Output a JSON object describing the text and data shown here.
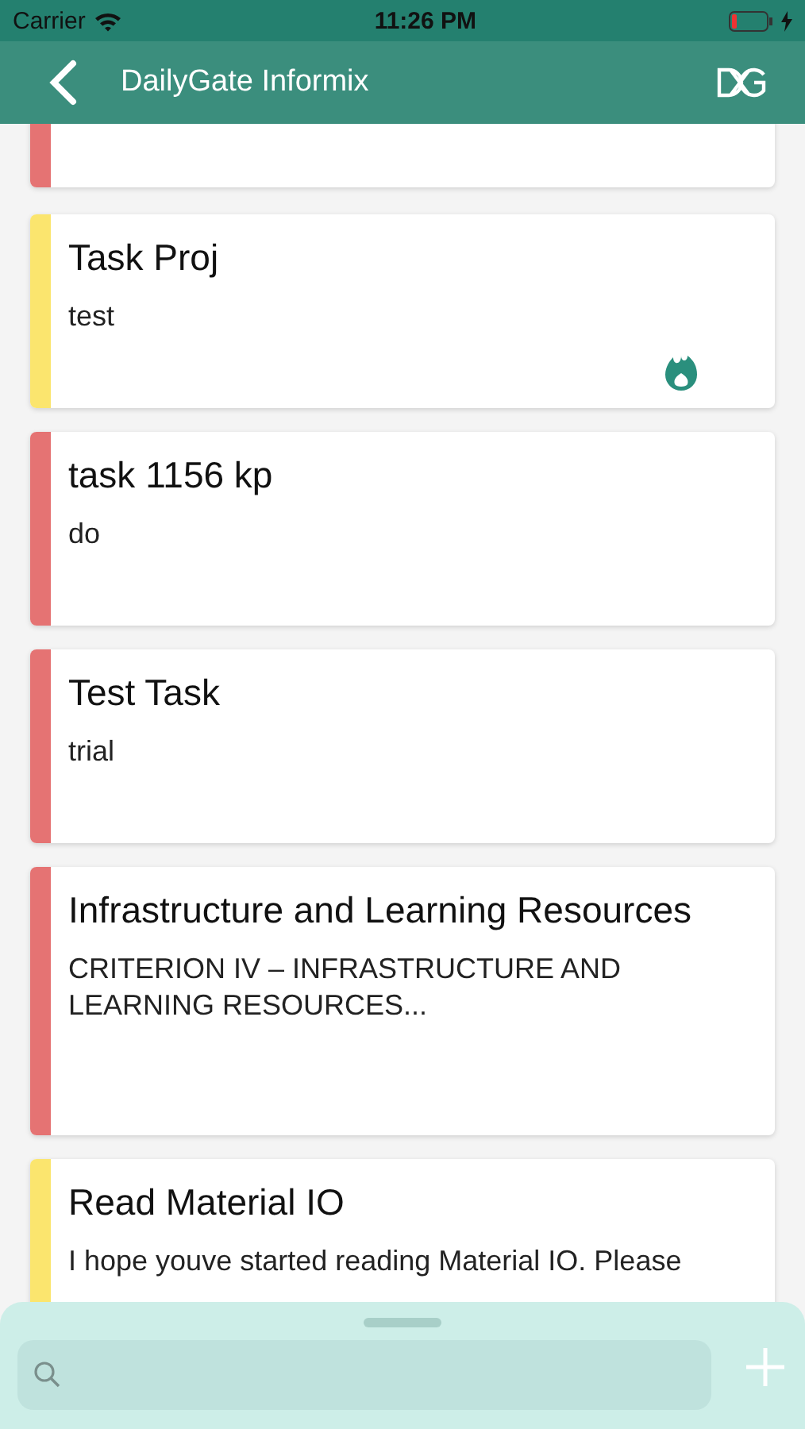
{
  "status_bar": {
    "carrier": "Carrier",
    "time": "11:26 PM",
    "battery_low": true,
    "charging": true
  },
  "header": {
    "title": "DailyGate Informix"
  },
  "tasks": [
    {
      "color": "#e57373"
    },
    {
      "title": "Task Proj",
      "description": "test",
      "color": "#fbe56e",
      "hot": true
    },
    {
      "title": "task 1156 kp",
      "description": "do",
      "color": "#e57373",
      "hot": false
    },
    {
      "title": "Test Task",
      "description": "trial",
      "color": "#e57373",
      "hot": false
    },
    {
      "title": "Infrastructure and Learning Resources",
      "description": "CRITERION IV – INFRASTRUCTURE AND LEARNING RESOURCES...",
      "color": "#e57373",
      "hot": false,
      "kind": "caps"
    },
    {
      "title": "Read Material IO",
      "description": "I hope youve started reading Material IO. Please",
      "color": "#fbe56e",
      "hot": false
    }
  ]
}
